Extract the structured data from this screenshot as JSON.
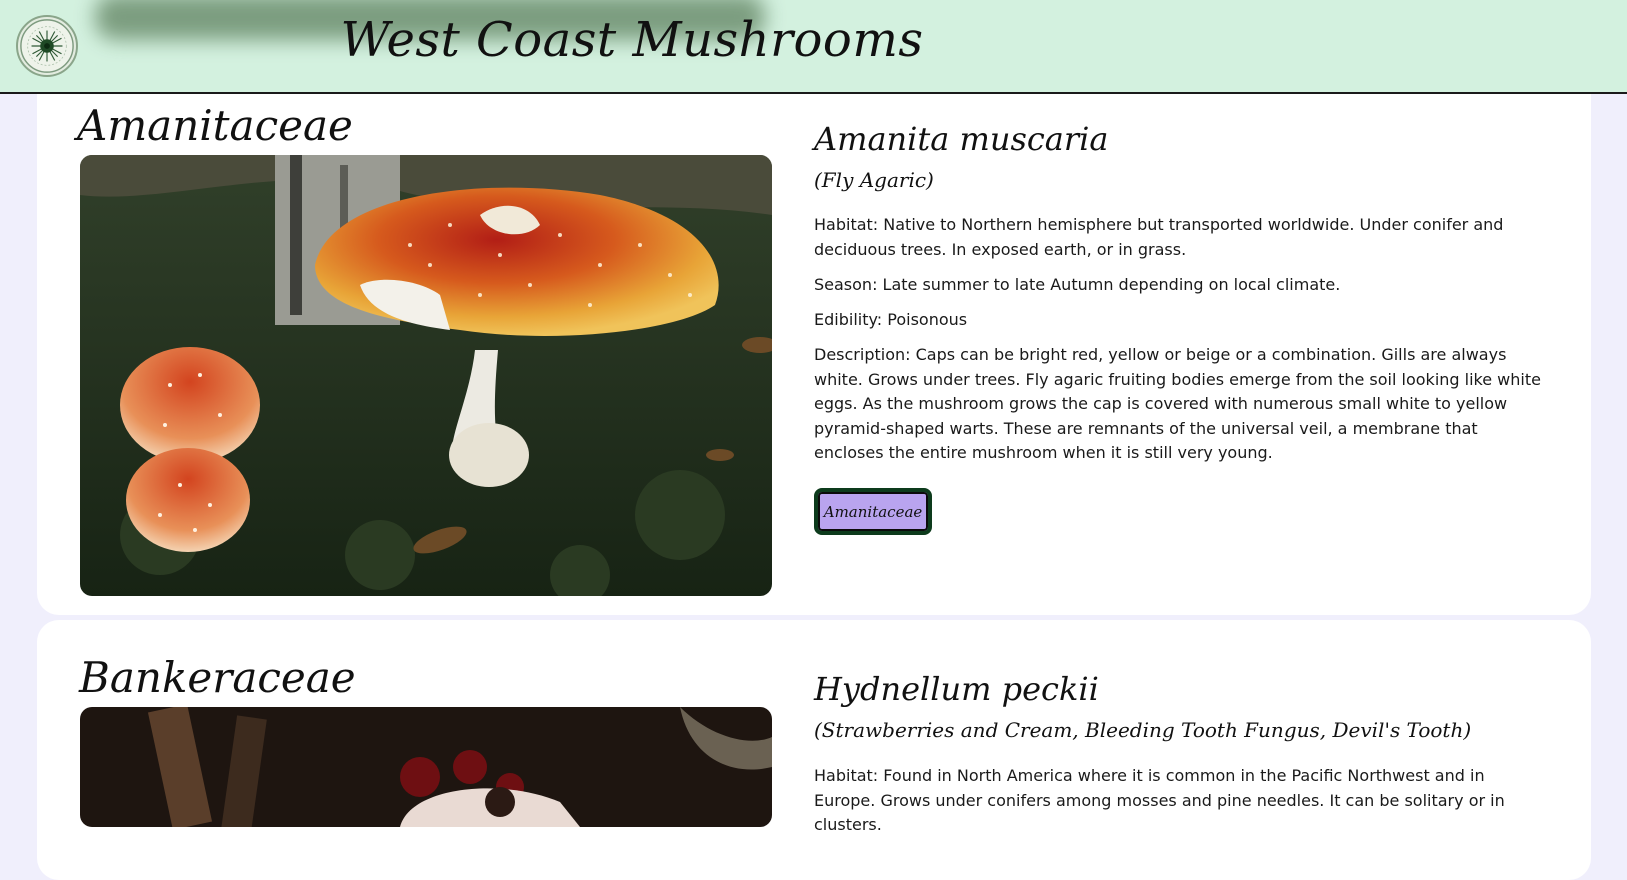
{
  "header": {
    "title": "West Coast Mushrooms",
    "logo_icon": "mushroom-logo-icon"
  },
  "entries": [
    {
      "family": "Amanitaceae",
      "species": "Amanita muscaria",
      "common_names": "(Fly Agaric)",
      "habitat": "Habitat: Native to Northern hemisphere but transported worldwide. Under conifer and deciduous trees. In exposed earth, or in grass.",
      "season": "Season: Late summer to late Autumn depending on local climate.",
      "edibility": "Edibility: Poisonous",
      "description": "Description: Caps can be bright red, yellow or beige or a combination. Gills are always white. Grows under trees. Fly agaric fruiting bodies emerge from the soil looking like white eggs. As the mushroom grows the cap is covered with numerous small white to yellow pyramid-shaped warts. These are remnants of the universal veil, a membrane that encloses the entire mushroom when it is still very young.",
      "family_button": "Amanitaceae"
    },
    {
      "family": "Bankeraceae",
      "species": "Hydnellum peckii",
      "common_names": "(Strawberries and Cream, Bleeding Tooth Fungus, Devil's Tooth)",
      "habitat": "Habitat: Found in North America where it is common in the Pacific Northwest and in Europe. Grows under conifers among mosses and pine needles. It can be solitary or in clusters."
    }
  ],
  "colors": {
    "header_bg": "#d3f1df",
    "page_bg": "#f0effc",
    "card_bg": "#ffffff",
    "button_bg": "#b9a4ef",
    "button_border": "#0d3b1c"
  }
}
